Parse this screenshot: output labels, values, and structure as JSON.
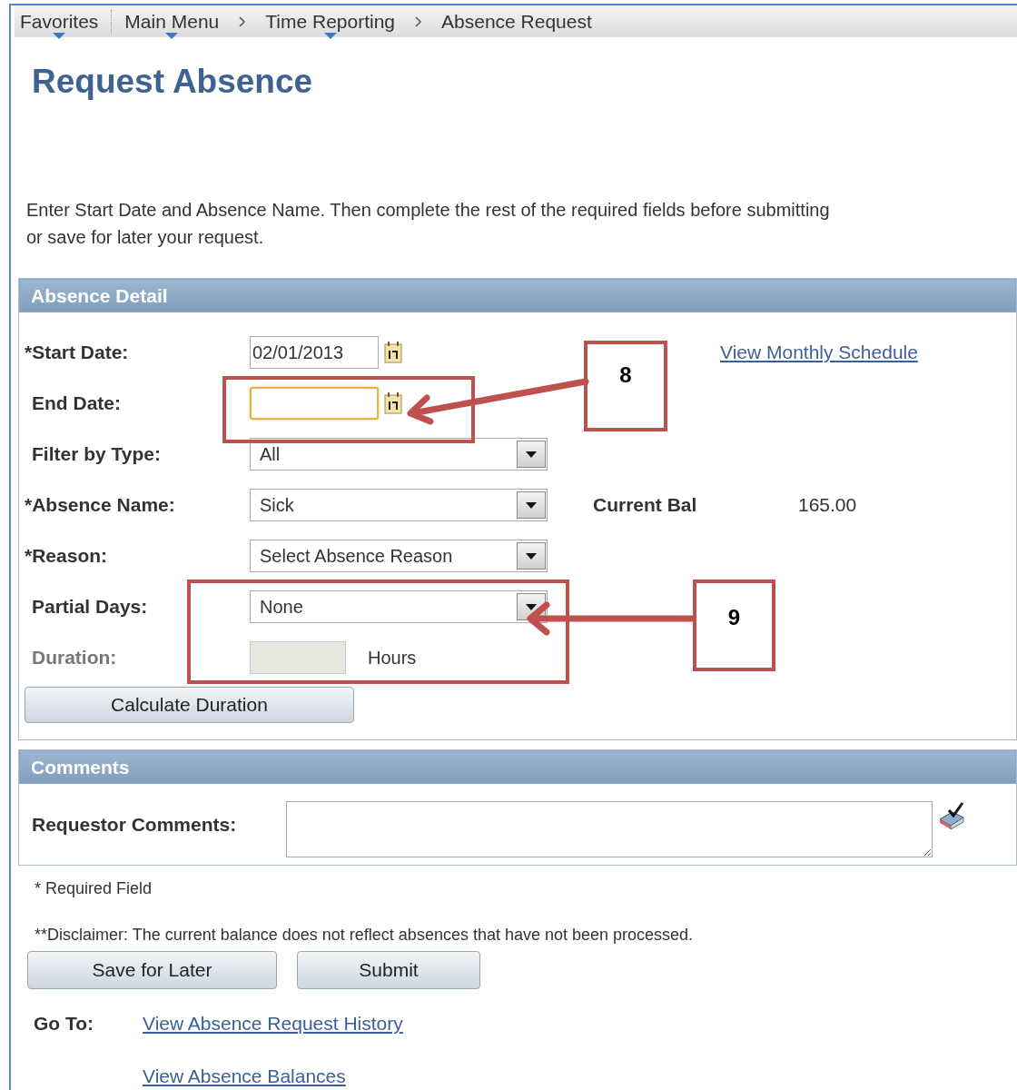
{
  "breadcrumb": [
    {
      "label": "Favorites",
      "menu": true
    },
    {
      "label": "Main Menu",
      "menu": true
    },
    {
      "label": "Time Reporting",
      "menu": true
    },
    {
      "label": "Absence Request",
      "menu": false
    }
  ],
  "title": "Request Absence",
  "instructions": "Enter Start Date and Absence Name. Then complete the rest of the required fields before submitting or save for later your request.",
  "absence_detail": {
    "title": "Absence Detail",
    "fields": [
      {
        "kind": "date",
        "label": "*Start Date:",
        "value": "02/01/2013",
        "focused": false,
        "disabled": false,
        "aside": {
          "kind": "link",
          "text": "View Monthly Schedule"
        }
      },
      {
        "kind": "date",
        "label": "End Date:",
        "focused": true,
        "disabled": false
      },
      {
        "kind": "select",
        "label": "Filter by Type:",
        "value": "All",
        "focused": false,
        "disabled": false
      },
      {
        "kind": "select",
        "label": "*Absence Name:",
        "value": "Sick",
        "focused": false,
        "disabled": false,
        "aside": {
          "kind": "balance",
          "label": "Current Bal",
          "value": "165.00"
        }
      },
      {
        "kind": "select",
        "label": "*Reason:",
        "value": "Select Absence Reason",
        "focused": false,
        "disabled": false
      },
      {
        "kind": "select",
        "label": "Partial Days:",
        "value": "None",
        "focused": false,
        "disabled": false
      },
      {
        "kind": "number",
        "label": "Duration:",
        "unit": "Hours",
        "focused": false,
        "disabled": true
      }
    ],
    "calculate_button": "Calculate Duration"
  },
  "comments": {
    "title": "Comments",
    "label": "Requestor Comments:"
  },
  "required_note": "* Required Field",
  "disclaimer": "**Disclaimer: The current balance does not reflect absences that have not been processed.",
  "buttons": [
    "Save for Later",
    "Submit"
  ],
  "goto": {
    "label": "Go To:",
    "links": [
      "View Absence Request History",
      "View Absence Balances"
    ]
  },
  "callouts": [
    {
      "number": "8"
    },
    {
      "number": "9"
    }
  ]
}
